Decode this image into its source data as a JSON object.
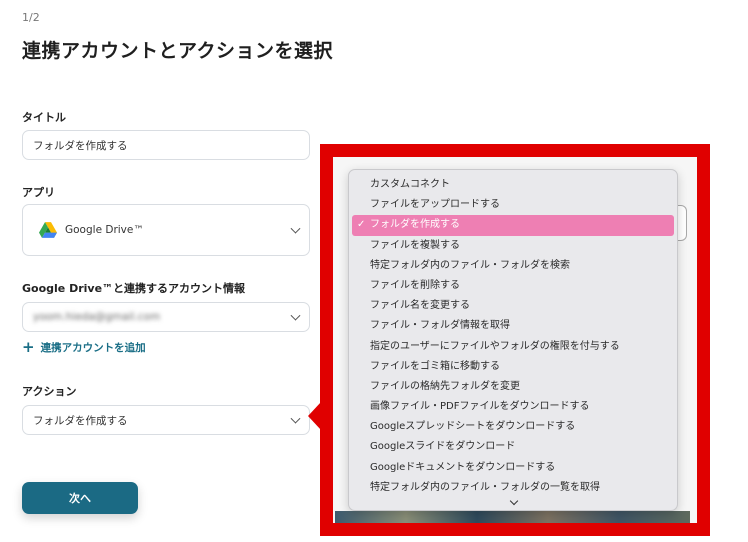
{
  "header": {
    "step": "1/2",
    "title": "連携アカウントとアクションを選択"
  },
  "form": {
    "title_label": "タイトル",
    "title_value": "フォルダを作成する",
    "app_label": "アプリ",
    "app_value": "Google Drive™",
    "account_label": "Google Drive™と連携するアカウント情報",
    "account_value": "yoom.hieda@gmail.com",
    "add_account_link": "連携アカウントを追加",
    "action_label": "アクション",
    "action_value": "フォルダを作成する",
    "next_button": "次へ"
  },
  "dropdown": {
    "check_mark": "✓",
    "selected_index": 2,
    "items": [
      "カスタムコネクト",
      "ファイルをアップロードする",
      "フォルダを作成する",
      "ファイルを複製する",
      "特定フォルダ内のファイル・フォルダを検索",
      "ファイルを削除する",
      "ファイル名を変更する",
      "ファイル・フォルダ情報を取得",
      "指定のユーザーにファイルやフォルダの権限を付与する",
      "ファイルをゴミ箱に移動する",
      "ファイルの格納先フォルダを変更",
      "画像ファイル・PDFファイルをダウンロードする",
      "Googleスプレッドシートをダウンロードする",
      "Googleスライドをダウンロード",
      "Googleドキュメントをダウンロードする",
      "特定フォルダ内のファイル・フォルダの一覧を取得"
    ]
  },
  "colors": {
    "accent": "#1b6a84",
    "highlight": "#e00000",
    "selected": "#ee7fb3"
  },
  "icons": [
    "google-drive-icon",
    "chevron-down-icon",
    "plus-icon",
    "checkmark-icon"
  ]
}
